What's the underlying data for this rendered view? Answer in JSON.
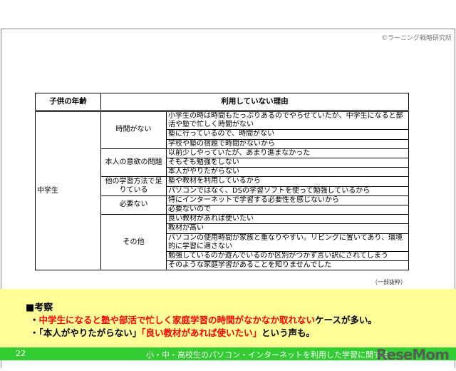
{
  "copyright": "©ラーニング戦略研究所",
  "table": {
    "headers": [
      "子供の年齢",
      "利用していない理由"
    ],
    "age": "中学生",
    "groups": [
      {
        "category": "時間がない",
        "reasons": [
          "小学生の時は時間もたっぷりあるのでやらせていたが、中学生になると部活や塾で忙しく時間がない",
          "塾に行っているので、時間がない",
          "学校や塾の宿題で時間がないから"
        ]
      },
      {
        "category": "本人の意欲の問題",
        "reasons": [
          "以前少しやっていたが、あまり進まなかった",
          "そもそも勉強をしない",
          "本人がやりたがらない"
        ]
      },
      {
        "category": "他の学習方法で足りている",
        "reasons": [
          "塾や教材を利用しているから",
          "パソコンではなく、DSの学習ソフトを使って勉強しているから"
        ]
      },
      {
        "category": "必要ない",
        "reasons": [
          "特にインターネットで学習する必要性を感じないから",
          "必要ないので"
        ]
      },
      {
        "category": "その他",
        "reasons": [
          "良い教材があれば使いたい",
          "教材が高い",
          "パソコンの使用時間が家族と重なりやすい。リビングに置いてあり、環境的に学習に適さない",
          "勉強しているのか遊んでいるのか区別がつかず言い訳にされてしまう",
          "そのような家庭学習があることを知りませんでした"
        ]
      }
    ]
  },
  "note": "（一部抜粋）",
  "summary": {
    "heading": "■考察",
    "line1_prefix": "・",
    "line1_red": "中学生になると塾や部活で忙しく家庭学習の時間がなかなか取れない",
    "line1_rest": "ケースが多い。",
    "line2_a": "・「本人がやりたがらない」",
    "line2_red": "「良い教材があれば使いたい」",
    "line2_rest": "という声も。"
  },
  "footer": {
    "page": "22",
    "title": "小・中・高校生のパソコン・インターネットを利用した学習に関する",
    "logo": "ReseMom"
  }
}
